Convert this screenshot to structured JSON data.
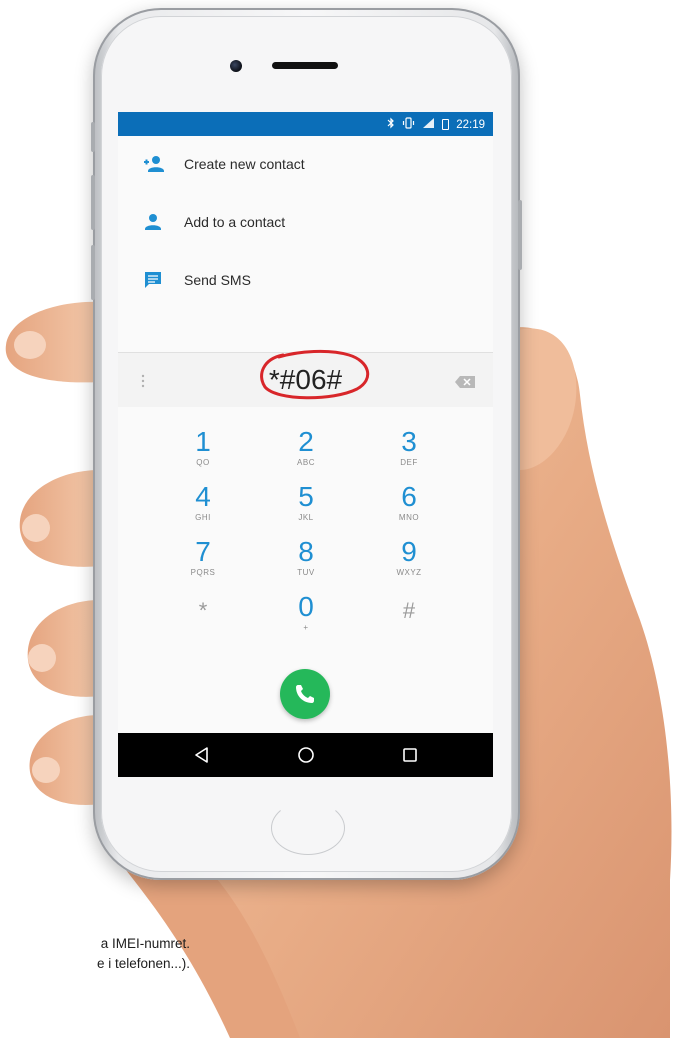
{
  "status_bar": {
    "time": "22:19",
    "icons": [
      "bluetooth-icon",
      "vibrate-icon",
      "signal-icon",
      "battery-icon"
    ],
    "color": "#0b6eb8"
  },
  "menu": {
    "items": [
      {
        "label": "Create new contact",
        "icon": "add-person-icon"
      },
      {
        "label": "Add to a contact",
        "icon": "person-icon"
      },
      {
        "label": "Send SMS",
        "icon": "message-icon"
      }
    ]
  },
  "dialer": {
    "number": "*#06#",
    "keys": [
      {
        "digit": "1",
        "sub": "QO"
      },
      {
        "digit": "2",
        "sub": "ABC"
      },
      {
        "digit": "3",
        "sub": "DEF"
      },
      {
        "digit": "4",
        "sub": "GHI"
      },
      {
        "digit": "5",
        "sub": "JKL"
      },
      {
        "digit": "6",
        "sub": "MNO"
      },
      {
        "digit": "7",
        "sub": "PQRS"
      },
      {
        "digit": "8",
        "sub": "TUV"
      },
      {
        "digit": "9",
        "sub": "WXYZ"
      },
      {
        "digit": "*",
        "sub": ""
      },
      {
        "digit": "0",
        "sub": "+"
      },
      {
        "digit": "#",
        "sub": ""
      }
    ],
    "accent": "#1f8fd2",
    "call_color": "#25b85a"
  },
  "caption": {
    "line1": "a IMEI-numret.",
    "line2": "e i telefonen...)."
  }
}
